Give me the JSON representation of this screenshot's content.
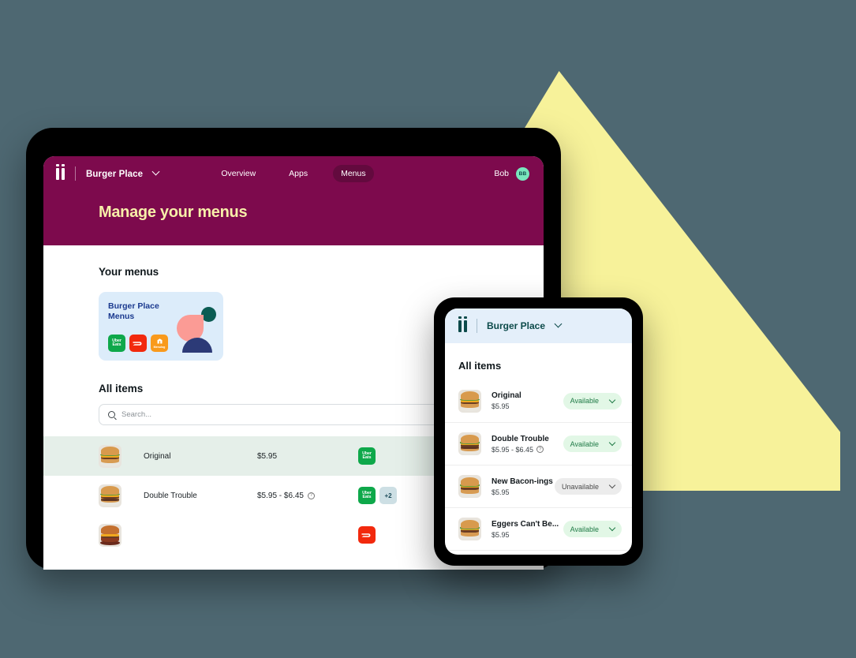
{
  "colors": {
    "background": "#4e6872",
    "wedge_yellow": "#f7f29a",
    "tablet_header_magenta": "#7d0a4d",
    "page_title_yellow": "#f7efa9",
    "menu_card_blue": "#dcecfa",
    "menu_card_title_blue": "#1b3a8f",
    "phone_header_blue": "#e4effa",
    "phone_brand_teal": "#0c4a4a",
    "avatar_mint": "#79e6bd",
    "available_bg": "#e2f7e6",
    "available_text": "#1f7a46",
    "unavailable_bg": "#ececec",
    "row_highlight": "#e5efe9",
    "ubereats_green": "#0ea84a",
    "doordash_red": "#f2290d",
    "menulog_orange": "#f99a1c"
  },
  "tablet": {
    "logo_icon": "ii-logo-icon",
    "brand": "Burger Place",
    "brand_chevron_icon": "chevron-down-icon",
    "nav": [
      {
        "label": "Overview",
        "active": false
      },
      {
        "label": "Apps",
        "active": false
      },
      {
        "label": "Menus",
        "active": true
      }
    ],
    "user": {
      "name": "Bob",
      "initials": "BB"
    },
    "page_title": "Manage your menus",
    "your_menus_title": "Your menus",
    "menu_card": {
      "title": "Burger Place\nMenus",
      "platforms": [
        {
          "name": "Uber Eats",
          "icon": "ubereats-icon",
          "label": "Uber\nEats"
        },
        {
          "name": "DoorDash",
          "icon": "doordash-icon",
          "label": ""
        },
        {
          "name": "Menulog",
          "icon": "menulog-icon",
          "label": "Menulog"
        }
      ]
    },
    "all_items_title": "All items",
    "search": {
      "placeholder": "Search...",
      "value": "",
      "icon": "search-icon"
    },
    "rows": [
      {
        "name": "Original",
        "price": "$5.95",
        "has_info_icon": false,
        "badges": [
          "ubereats-icon"
        ],
        "overflow": "",
        "highlighted": true
      },
      {
        "name": "Double Trouble",
        "price": "$5.95 - $6.45",
        "has_info_icon": true,
        "badges": [
          "ubereats-icon"
        ],
        "overflow": "+2",
        "highlighted": false
      },
      {
        "name": "",
        "price": "",
        "has_info_icon": false,
        "badges": [
          "doordash-icon"
        ],
        "overflow": "",
        "highlighted": false
      }
    ]
  },
  "phone": {
    "logo_icon": "ii-logo-icon",
    "brand": "Burger Place",
    "brand_chevron_icon": "chevron-down-icon",
    "all_items_title": "All items",
    "rows": [
      {
        "name": "Original",
        "price": "$5.95",
        "has_info_icon": false,
        "status": "Available",
        "status_type": "avail",
        "chevron_icon": "chevron-down-icon"
      },
      {
        "name": "Double Trouble",
        "price": "$5.95 - $6.45",
        "has_info_icon": true,
        "status": "Available",
        "status_type": "avail",
        "chevron_icon": "chevron-down-icon"
      },
      {
        "name": "New Bacon-ings",
        "price": "$5.95",
        "has_info_icon": false,
        "status": "Unavailable",
        "status_type": "unavail",
        "chevron_icon": "chevron-down-icon"
      },
      {
        "name": "Eggers Can't Be...",
        "price": "$5.95",
        "has_info_icon": false,
        "status": "Available",
        "status_type": "avail",
        "chevron_icon": "chevron-down-icon"
      }
    ]
  }
}
